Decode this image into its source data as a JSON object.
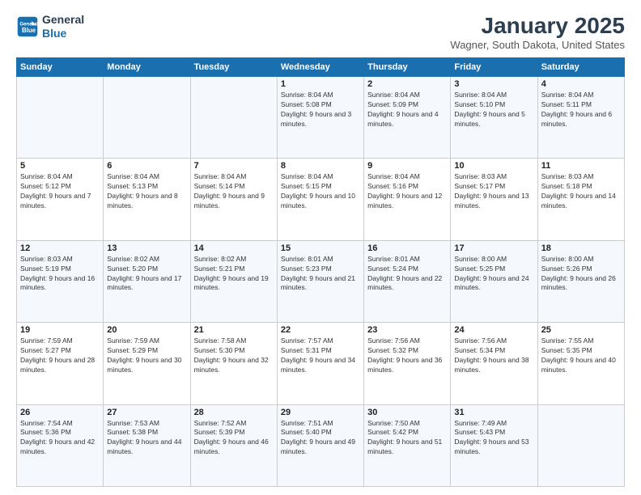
{
  "header": {
    "logo_line1": "General",
    "logo_line2": "Blue",
    "month_title": "January 2025",
    "location": "Wagner, South Dakota, United States"
  },
  "weekdays": [
    "Sunday",
    "Monday",
    "Tuesday",
    "Wednesday",
    "Thursday",
    "Friday",
    "Saturday"
  ],
  "weeks": [
    [
      {
        "day": "",
        "info": ""
      },
      {
        "day": "",
        "info": ""
      },
      {
        "day": "",
        "info": ""
      },
      {
        "day": "1",
        "info": "Sunrise: 8:04 AM\nSunset: 5:08 PM\nDaylight: 9 hours and 3 minutes."
      },
      {
        "day": "2",
        "info": "Sunrise: 8:04 AM\nSunset: 5:09 PM\nDaylight: 9 hours and 4 minutes."
      },
      {
        "day": "3",
        "info": "Sunrise: 8:04 AM\nSunset: 5:10 PM\nDaylight: 9 hours and 5 minutes."
      },
      {
        "day": "4",
        "info": "Sunrise: 8:04 AM\nSunset: 5:11 PM\nDaylight: 9 hours and 6 minutes."
      }
    ],
    [
      {
        "day": "5",
        "info": "Sunrise: 8:04 AM\nSunset: 5:12 PM\nDaylight: 9 hours and 7 minutes."
      },
      {
        "day": "6",
        "info": "Sunrise: 8:04 AM\nSunset: 5:13 PM\nDaylight: 9 hours and 8 minutes."
      },
      {
        "day": "7",
        "info": "Sunrise: 8:04 AM\nSunset: 5:14 PM\nDaylight: 9 hours and 9 minutes."
      },
      {
        "day": "8",
        "info": "Sunrise: 8:04 AM\nSunset: 5:15 PM\nDaylight: 9 hours and 10 minutes."
      },
      {
        "day": "9",
        "info": "Sunrise: 8:04 AM\nSunset: 5:16 PM\nDaylight: 9 hours and 12 minutes."
      },
      {
        "day": "10",
        "info": "Sunrise: 8:03 AM\nSunset: 5:17 PM\nDaylight: 9 hours and 13 minutes."
      },
      {
        "day": "11",
        "info": "Sunrise: 8:03 AM\nSunset: 5:18 PM\nDaylight: 9 hours and 14 minutes."
      }
    ],
    [
      {
        "day": "12",
        "info": "Sunrise: 8:03 AM\nSunset: 5:19 PM\nDaylight: 9 hours and 16 minutes."
      },
      {
        "day": "13",
        "info": "Sunrise: 8:02 AM\nSunset: 5:20 PM\nDaylight: 9 hours and 17 minutes."
      },
      {
        "day": "14",
        "info": "Sunrise: 8:02 AM\nSunset: 5:21 PM\nDaylight: 9 hours and 19 minutes."
      },
      {
        "day": "15",
        "info": "Sunrise: 8:01 AM\nSunset: 5:23 PM\nDaylight: 9 hours and 21 minutes."
      },
      {
        "day": "16",
        "info": "Sunrise: 8:01 AM\nSunset: 5:24 PM\nDaylight: 9 hours and 22 minutes."
      },
      {
        "day": "17",
        "info": "Sunrise: 8:00 AM\nSunset: 5:25 PM\nDaylight: 9 hours and 24 minutes."
      },
      {
        "day": "18",
        "info": "Sunrise: 8:00 AM\nSunset: 5:26 PM\nDaylight: 9 hours and 26 minutes."
      }
    ],
    [
      {
        "day": "19",
        "info": "Sunrise: 7:59 AM\nSunset: 5:27 PM\nDaylight: 9 hours and 28 minutes."
      },
      {
        "day": "20",
        "info": "Sunrise: 7:59 AM\nSunset: 5:29 PM\nDaylight: 9 hours and 30 minutes."
      },
      {
        "day": "21",
        "info": "Sunrise: 7:58 AM\nSunset: 5:30 PM\nDaylight: 9 hours and 32 minutes."
      },
      {
        "day": "22",
        "info": "Sunrise: 7:57 AM\nSunset: 5:31 PM\nDaylight: 9 hours and 34 minutes."
      },
      {
        "day": "23",
        "info": "Sunrise: 7:56 AM\nSunset: 5:32 PM\nDaylight: 9 hours and 36 minutes."
      },
      {
        "day": "24",
        "info": "Sunrise: 7:56 AM\nSunset: 5:34 PM\nDaylight: 9 hours and 38 minutes."
      },
      {
        "day": "25",
        "info": "Sunrise: 7:55 AM\nSunset: 5:35 PM\nDaylight: 9 hours and 40 minutes."
      }
    ],
    [
      {
        "day": "26",
        "info": "Sunrise: 7:54 AM\nSunset: 5:36 PM\nDaylight: 9 hours and 42 minutes."
      },
      {
        "day": "27",
        "info": "Sunrise: 7:53 AM\nSunset: 5:38 PM\nDaylight: 9 hours and 44 minutes."
      },
      {
        "day": "28",
        "info": "Sunrise: 7:52 AM\nSunset: 5:39 PM\nDaylight: 9 hours and 46 minutes."
      },
      {
        "day": "29",
        "info": "Sunrise: 7:51 AM\nSunset: 5:40 PM\nDaylight: 9 hours and 49 minutes."
      },
      {
        "day": "30",
        "info": "Sunrise: 7:50 AM\nSunset: 5:42 PM\nDaylight: 9 hours and 51 minutes."
      },
      {
        "day": "31",
        "info": "Sunrise: 7:49 AM\nSunset: 5:43 PM\nDaylight: 9 hours and 53 minutes."
      },
      {
        "day": "",
        "info": ""
      }
    ]
  ]
}
